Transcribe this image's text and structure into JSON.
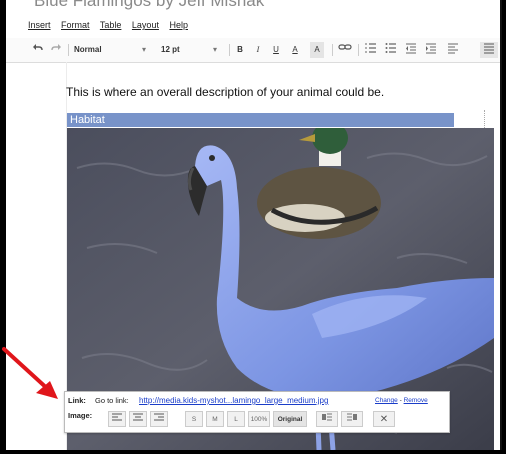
{
  "document": {
    "title": "Blue Flamingos by Jeff Mishak",
    "description": "This is where an overall description of your animal could be.",
    "section_heading": "Habitat"
  },
  "menu": [
    "Insert",
    "Format",
    "Table",
    "Layout",
    "Help"
  ],
  "toolbar": {
    "undo_icon": "undo-icon",
    "redo_icon": "redo-icon",
    "style": "Normal",
    "font_size": "12 pt",
    "bold": "B",
    "italic": "I",
    "underline": "U",
    "text_color": "A",
    "highlight": "A"
  },
  "image_bubble": {
    "link_label": "Link:",
    "go_to_link": "Go to link:",
    "url": "http://media.kids-myshot...lamingo_large_medium.jpg",
    "change": "Change",
    "remove": "Remove",
    "image_label": "Image:",
    "size_s": "S",
    "size_m": "M",
    "size_l": "L",
    "size_100": "100%",
    "size_original": "Original",
    "close": "✕"
  },
  "colors": {
    "heading_bg": "#7893c9",
    "link": "#1a3dc9",
    "flamingo": "#8aa2ec",
    "annotation_arrow": "#e0161b"
  }
}
